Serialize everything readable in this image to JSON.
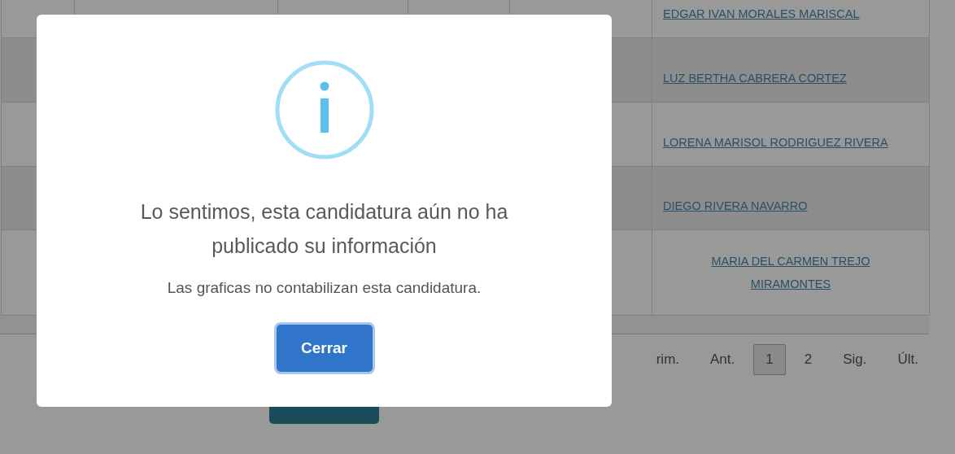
{
  "table": {
    "rows": [
      {
        "name": "EDGAR IVAN MORALES MARISCAL"
      },
      {
        "name": "LUZ BERTHA CABRERA CORTEZ"
      },
      {
        "name": "LORENA MARISOL RODRIGUEZ RIVERA"
      },
      {
        "name": "DIEGO RIVERA NAVARRO"
      },
      {
        "name": "MARIA DEL CARMEN TREJO MIRAMONTES"
      }
    ]
  },
  "pagination": [
    {
      "label": "rim.",
      "selected": false
    },
    {
      "label": "Ant.",
      "selected": false
    },
    {
      "label": "1",
      "selected": true
    },
    {
      "label": "2",
      "selected": false
    },
    {
      "label": "Sig.",
      "selected": false
    },
    {
      "label": "Últ.",
      "selected": false
    }
  ],
  "modal": {
    "title": "Lo sentimos, esta candidatura aún no ha publicado su información",
    "text": "Las graficas no contabilizan esta candidatura.",
    "button": "Cerrar"
  }
}
